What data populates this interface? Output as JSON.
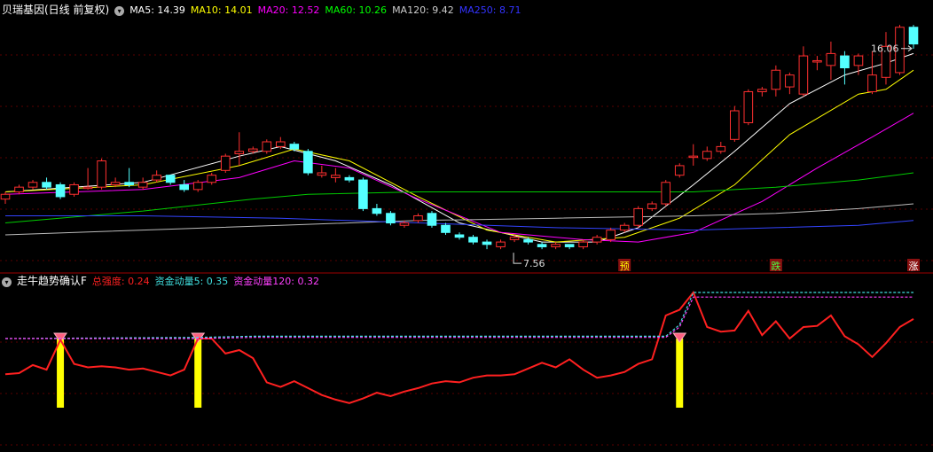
{
  "main_panel": {
    "title": "贝瑞基因(日线 前复权)",
    "indicators": [
      {
        "label": "MA5:",
        "value": "14.39",
        "color": "#ffffff"
      },
      {
        "label": "MA10:",
        "value": "14.01",
        "color": "#ffff00"
      },
      {
        "label": "MA20:",
        "value": "12.52",
        "color": "#ff00ff"
      },
      {
        "label": "MA60:",
        "value": "10.26",
        "color": "#00ff00"
      },
      {
        "label": "MA120:",
        "value": "9.42",
        "color": "#cccccc"
      },
      {
        "label": "MA250:",
        "value": "8.71",
        "color": "#3333ff"
      }
    ],
    "high_label": "16.06",
    "low_label": "7.56",
    "signals": [
      "预",
      "跌",
      "涨"
    ]
  },
  "sub_panel": {
    "title": "走牛趋势确认F",
    "indicators": [
      {
        "label": "总强度:",
        "value": "0.24",
        "color": "#ff2020"
      },
      {
        "label": "资金动量5:",
        "value": "0.35",
        "color": "#40e0e0"
      },
      {
        "label": "资金动量120:",
        "value": "0.32",
        "color": "#ff40ff"
      }
    ]
  },
  "chart_data": [
    {
      "type": "candlestick",
      "ylim": [
        6.8,
        17.2
      ],
      "candles": [
        [
          9.6,
          9.8,
          9.4,
          9.9
        ],
        [
          9.9,
          10.1,
          9.8,
          10.2
        ],
        [
          10.1,
          10.3,
          10.0,
          10.4
        ],
        [
          10.3,
          10.1,
          10.0,
          10.5
        ],
        [
          10.2,
          9.7,
          9.6,
          10.3
        ],
        [
          9.8,
          10.2,
          9.7,
          10.3
        ],
        [
          10.1,
          10.1,
          10.0,
          10.9
        ],
        [
          10.1,
          11.2,
          10.0,
          11.3
        ],
        [
          10.2,
          10.3,
          10.1,
          10.5
        ],
        [
          10.3,
          10.2,
          10.1,
          10.9
        ],
        [
          10.1,
          10.3,
          10.0,
          10.5
        ],
        [
          10.4,
          10.6,
          10.3,
          10.8
        ],
        [
          10.6,
          10.3,
          10.2,
          10.6
        ],
        [
          10.2,
          10.0,
          9.9,
          10.4
        ],
        [
          10.0,
          10.3,
          9.9,
          10.4
        ],
        [
          10.3,
          10.6,
          10.2,
          10.7
        ],
        [
          10.8,
          11.4,
          10.7,
          11.5
        ],
        [
          11.5,
          11.6,
          11.0,
          12.4
        ],
        [
          11.6,
          11.7,
          11.5,
          11.8
        ],
        [
          11.6,
          12.0,
          11.5,
          12.1
        ],
        [
          11.8,
          12.0,
          11.7,
          12.2
        ],
        [
          11.9,
          11.7,
          11.6,
          12.0
        ],
        [
          11.6,
          10.7,
          10.6,
          11.7
        ],
        [
          10.6,
          10.7,
          10.5,
          11.0
        ],
        [
          10.5,
          10.6,
          10.3,
          10.9
        ],
        [
          10.5,
          10.4,
          10.3,
          10.6
        ],
        [
          10.4,
          9.2,
          9.1,
          10.5
        ],
        [
          9.2,
          9.0,
          8.9,
          9.4
        ],
        [
          9.0,
          8.6,
          8.5,
          9.1
        ],
        [
          8.5,
          8.6,
          8.4,
          8.7
        ],
        [
          8.7,
          8.9,
          8.6,
          9.0
        ],
        [
          9.0,
          8.5,
          8.4,
          9.1
        ],
        [
          8.5,
          8.2,
          8.1,
          8.6
        ],
        [
          8.1,
          8.0,
          7.9,
          8.2
        ],
        [
          8.0,
          7.8,
          7.7,
          8.1
        ],
        [
          7.8,
          7.7,
          7.5,
          7.9
        ],
        [
          7.6,
          7.8,
          7.5,
          7.9
        ],
        [
          7.9,
          8.0,
          7.8,
          8.1
        ],
        [
          7.9,
          7.8,
          7.7,
          8.0
        ],
        [
          7.7,
          7.6,
          7.5,
          7.8
        ],
        [
          7.6,
          7.7,
          7.5,
          7.8
        ],
        [
          7.7,
          7.6,
          7.5,
          7.7
        ],
        [
          7.6,
          7.8,
          7.5,
          7.9
        ],
        [
          7.8,
          8.0,
          7.7,
          8.1
        ],
        [
          7.9,
          8.3,
          7.8,
          8.4
        ],
        [
          8.3,
          8.5,
          8.2,
          8.6
        ],
        [
          8.5,
          9.2,
          8.4,
          9.3
        ],
        [
          9.2,
          9.4,
          9.1,
          9.5
        ],
        [
          9.4,
          10.3,
          9.3,
          10.4
        ],
        [
          10.6,
          11.0,
          10.5,
          11.1
        ],
        [
          11.4,
          11.4,
          11.0,
          11.9
        ],
        [
          11.3,
          11.6,
          11.2,
          11.8
        ],
        [
          11.6,
          11.8,
          11.5,
          12.0
        ],
        [
          12.1,
          13.3,
          12.0,
          13.5
        ],
        [
          12.8,
          14.1,
          12.7,
          14.2
        ],
        [
          14.1,
          14.2,
          13.9,
          14.3
        ],
        [
          14.2,
          15.0,
          13.9,
          15.2
        ],
        [
          14.3,
          14.8,
          14.0,
          14.9
        ],
        [
          14.0,
          15.6,
          13.9,
          16.0
        ],
        [
          15.4,
          15.4,
          15.0,
          15.6
        ],
        [
          15.2,
          15.7,
          14.6,
          16.2
        ],
        [
          15.6,
          15.1,
          14.4,
          15.8
        ],
        [
          15.2,
          15.6,
          14.8,
          15.7
        ],
        [
          14.1,
          14.8,
          14.0,
          15.8
        ],
        [
          14.7,
          16.0,
          14.4,
          16.6
        ],
        [
          14.9,
          16.8,
          14.8,
          16.9
        ],
        [
          16.8,
          16.1,
          15.9,
          16.9
        ]
      ],
      "ma_lines": {
        "MA5": [
          [
            0,
            9.9
          ],
          [
            10,
            10.3
          ],
          [
            17,
            11.4
          ],
          [
            20,
            11.8
          ],
          [
            24,
            11.2
          ],
          [
            28,
            10.2
          ],
          [
            33,
            8.6
          ],
          [
            39,
            7.8
          ],
          [
            43,
            7.8
          ],
          [
            46,
            8.4
          ],
          [
            50,
            10.2
          ],
          [
            53,
            11.6
          ],
          [
            57,
            13.6
          ],
          [
            61,
            14.8
          ],
          [
            64,
            15.3
          ],
          [
            66,
            15.7
          ]
        ],
        "MA10": [
          [
            0,
            9.9
          ],
          [
            10,
            10.2
          ],
          [
            17,
            11.0
          ],
          [
            21,
            11.7
          ],
          [
            25,
            11.2
          ],
          [
            30,
            9.7
          ],
          [
            35,
            8.3
          ],
          [
            40,
            7.8
          ],
          [
            45,
            8.0
          ],
          [
            49,
            8.8
          ],
          [
            53,
            10.2
          ],
          [
            57,
            12.3
          ],
          [
            62,
            14.0
          ],
          [
            64,
            14.2
          ],
          [
            66,
            15.0
          ]
        ],
        "MA20": [
          [
            0,
            9.8
          ],
          [
            10,
            10.0
          ],
          [
            17,
            10.5
          ],
          [
            21,
            11.2
          ],
          [
            25,
            10.9
          ],
          [
            30,
            9.6
          ],
          [
            36,
            8.2
          ],
          [
            42,
            7.9
          ],
          [
            46,
            7.8
          ],
          [
            50,
            8.2
          ],
          [
            55,
            9.5
          ],
          [
            59,
            10.9
          ],
          [
            63,
            12.2
          ],
          [
            66,
            13.2
          ]
        ],
        "MA60": [
          [
            0,
            8.6
          ],
          [
            10,
            9.1
          ],
          [
            18,
            9.6
          ],
          [
            22,
            9.8
          ],
          [
            30,
            9.9
          ],
          [
            40,
            9.9
          ],
          [
            50,
            9.9
          ],
          [
            56,
            10.1
          ],
          [
            62,
            10.4
          ],
          [
            66,
            10.7
          ]
        ],
        "MA120": [
          [
            0,
            8.1
          ],
          [
            10,
            8.3
          ],
          [
            20,
            8.5
          ],
          [
            30,
            8.7
          ],
          [
            40,
            8.8
          ],
          [
            50,
            8.9
          ],
          [
            56,
            9.0
          ],
          [
            62,
            9.2
          ],
          [
            66,
            9.4
          ]
        ],
        "MA250": [
          [
            0,
            8.9
          ],
          [
            10,
            8.9
          ],
          [
            20,
            8.8
          ],
          [
            30,
            8.6
          ],
          [
            40,
            8.4
          ],
          [
            50,
            8.3
          ],
          [
            56,
            8.4
          ],
          [
            62,
            8.5
          ],
          [
            66,
            8.7
          ]
        ]
      },
      "high_annotation": {
        "index": 66,
        "value": 16.06
      },
      "low_annotation": {
        "index": 37,
        "value": 7.56
      },
      "signal_positions": [
        45,
        56,
        66
      ]
    },
    {
      "type": "line",
      "ylim": [
        0,
        1
      ],
      "series": [
        {
          "name": "总强度",
          "color": "#ff2020",
          "points": [
            [
              0,
              0.29
            ],
            [
              1,
              0.3
            ],
            [
              2,
              0.37
            ],
            [
              3,
              0.33
            ],
            [
              4,
              0.59
            ],
            [
              5,
              0.38
            ],
            [
              6,
              0.35
            ],
            [
              7,
              0.36
            ],
            [
              8,
              0.35
            ],
            [
              9,
              0.33
            ],
            [
              10,
              0.34
            ],
            [
              11,
              0.31
            ],
            [
              12,
              0.28
            ],
            [
              13,
              0.33
            ],
            [
              14,
              0.6
            ],
            [
              15,
              0.6
            ],
            [
              16,
              0.47
            ],
            [
              17,
              0.5
            ],
            [
              18,
              0.43
            ],
            [
              19,
              0.22
            ],
            [
              20,
              0.18
            ],
            [
              21,
              0.23
            ],
            [
              22,
              0.17
            ],
            [
              23,
              0.11
            ],
            [
              24,
              0.07
            ],
            [
              25,
              0.04
            ],
            [
              26,
              0.08
            ],
            [
              27,
              0.13
            ],
            [
              28,
              0.1
            ],
            [
              29,
              0.14
            ],
            [
              30,
              0.17
            ],
            [
              31,
              0.21
            ],
            [
              32,
              0.23
            ],
            [
              33,
              0.22
            ],
            [
              34,
              0.26
            ],
            [
              35,
              0.28
            ],
            [
              36,
              0.28
            ],
            [
              37,
              0.29
            ],
            [
              38,
              0.34
            ],
            [
              39,
              0.39
            ],
            [
              40,
              0.35
            ],
            [
              41,
              0.42
            ],
            [
              42,
              0.33
            ],
            [
              43,
              0.26
            ],
            [
              44,
              0.28
            ],
            [
              45,
              0.31
            ],
            [
              46,
              0.38
            ],
            [
              47,
              0.42
            ],
            [
              48,
              0.8
            ],
            [
              49,
              0.85
            ],
            [
              50,
              1.0
            ],
            [
              51,
              0.7
            ],
            [
              52,
              0.66
            ],
            [
              53,
              0.67
            ],
            [
              54,
              0.84
            ],
            [
              55,
              0.63
            ],
            [
              56,
              0.75
            ],
            [
              57,
              0.6
            ],
            [
              58,
              0.7
            ],
            [
              59,
              0.71
            ],
            [
              60,
              0.8
            ],
            [
              61,
              0.62
            ],
            [
              62,
              0.55
            ],
            [
              63,
              0.44
            ],
            [
              64,
              0.56
            ],
            [
              65,
              0.7
            ],
            [
              66,
              0.77
            ]
          ]
        },
        {
          "name": "资金动量5",
          "color": "#40e0e0",
          "points": [
            [
              0,
              0.6
            ],
            [
              14,
              0.61
            ],
            [
              18,
              0.62
            ],
            [
              48,
              0.62
            ],
            [
              49,
              0.72
            ],
            [
              50,
              1.0
            ],
            [
              66,
              1.0
            ]
          ]
        },
        {
          "name": "资金动量120",
          "color": "#ff40ff",
          "points": [
            [
              0,
              0.6
            ],
            [
              14,
              0.6
            ],
            [
              18,
              0.61
            ],
            [
              48,
              0.61
            ],
            [
              49,
              0.7
            ],
            [
              50,
              0.96
            ],
            [
              66,
              0.96
            ]
          ]
        }
      ],
      "signal_bars": [
        4,
        14,
        49
      ]
    }
  ]
}
